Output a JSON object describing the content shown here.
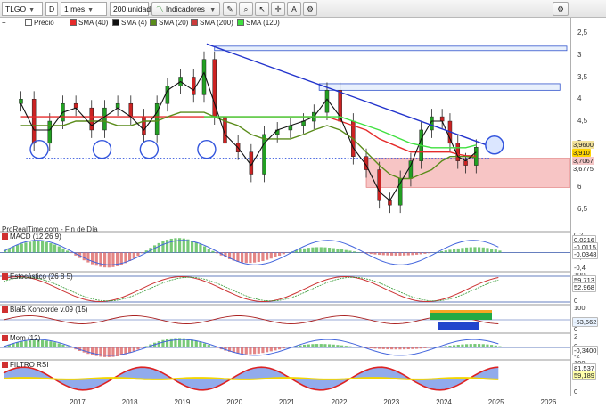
{
  "toolbar": {
    "ticker": "TLGO",
    "mode": "D",
    "period": "1 mes",
    "units": "200 unidades",
    "indicators_label": "Indicadores"
  },
  "legend": {
    "price_label": "Precio",
    "sma40": "SMA (40)",
    "sma4": "SMA (4)",
    "sma20": "SMA (20)",
    "sma200": "SMA (200)",
    "sma120": "SMA (120)"
  },
  "source_label": "ProRealTime.com - Fin de Día",
  "colors": {
    "up": "#22a022",
    "down": "#cc2222",
    "sma40": "#e52b2b",
    "sma4": "#111111",
    "sma20": "#5a8c1a",
    "sma120": "#3fe03f",
    "trendline": "#2233cc",
    "support": "#3355dd",
    "zone": "#f7c5c5"
  },
  "price_pane": {
    "axis_ticks": [
      "6,5",
      "6",
      "5,5",
      "5",
      "4,5",
      "4",
      "3,5",
      "3",
      "2,5"
    ],
    "badges": [
      {
        "text": "3,9600",
        "bg": "#f3e39c"
      },
      {
        "text": "3,910",
        "bg": "#ffd400"
      },
      {
        "text": "3,7067",
        "bg": "#f4c7c7"
      },
      {
        "text": "3,6775",
        "bg": "#ffffff"
      }
    ]
  },
  "panes": [
    {
      "title": "MACD (12 26 9)",
      "ticks": [
        "0,2",
        "0",
        "-0,2",
        "-0,4"
      ],
      "badges": [
        {
          "text": "0,0216",
          "bg": "#ffffff"
        },
        {
          "text": "-0,0115",
          "bg": "#ffffff"
        },
        {
          "text": "-0,0348",
          "bg": "#ffffff"
        }
      ]
    },
    {
      "title": "Estocástico (26 8 5)",
      "ticks": [
        "100",
        "0"
      ],
      "badges": [
        {
          "text": "59,713",
          "bg": "#ffffff"
        },
        {
          "text": "52,968",
          "bg": "#ffffff"
        }
      ]
    },
    {
      "title": "Blai5 Koncorde v.09 (15)",
      "ticks": [
        "100",
        "0"
      ],
      "badges": [
        {
          "text": "-53,662",
          "bg": "#e9f3ff"
        }
      ]
    },
    {
      "title": "Mom (12)",
      "ticks": [
        "2",
        "0",
        "-2"
      ],
      "badges": [
        {
          "text": "-0,3400",
          "bg": "#ffffff"
        }
      ]
    },
    {
      "title": "FILTRO RSI",
      "ticks": [
        "100",
        "0"
      ],
      "badges": [
        {
          "text": "81,537",
          "bg": "#ffffff"
        },
        {
          "text": "59,189",
          "bg": "#ffffaa"
        }
      ]
    }
  ],
  "chart_data": {
    "type": "line",
    "subtype": "candlestick",
    "title": "TLGO",
    "ticker": "TLGO",
    "timeframe": "1 mes",
    "x_ticks": [
      "2017",
      "2018",
      "2019",
      "2020",
      "2021",
      "2022",
      "2023",
      "2024",
      "2025",
      "2026"
    ],
    "ylim": [
      2.2,
      6.6
    ],
    "y_ticks": [
      2.5,
      3,
      3.5,
      4,
      4.5,
      5,
      5.5,
      6,
      6.5
    ],
    "x": [
      2016.4,
      2016.65,
      2016.95,
      2017.2,
      2017.45,
      2017.75,
      2018.0,
      2018.25,
      2018.5,
      2018.75,
      2019.0,
      2019.2,
      2019.45,
      2019.7,
      2019.9,
      2020.1,
      2020.3,
      2020.55,
      2020.8,
      2021.05,
      2021.3,
      2021.55,
      2021.8,
      2022.0,
      2022.25,
      2022.5,
      2022.75,
      2023.0,
      2023.25,
      2023.45,
      2023.65,
      2023.85,
      2024.05,
      2024.25,
      2024.45,
      2024.6,
      2024.75,
      2024.9,
      2025.1
    ],
    "series": [
      {
        "name": "Precio",
        "values": [
          5.0,
          4.0,
          4.5,
          4.9,
          4.8,
          4.3,
          4.8,
          4.9,
          4.6,
          4.2,
          4.9,
          5.3,
          5.5,
          5.1,
          5.9,
          4.6,
          4.0,
          3.8,
          3.3,
          4.2,
          4.3,
          4.4,
          4.5,
          4.7,
          5.2,
          4.5,
          3.7,
          3.4,
          2.7,
          2.6,
          3.2,
          3.6,
          4.3,
          4.6,
          4.5,
          4.0,
          3.6,
          3.5,
          3.91
        ]
      },
      {
        "name": "SMA (40)",
        "values": [
          4.6,
          4.6,
          4.6,
          4.6,
          4.6,
          4.6,
          4.6,
          4.6,
          4.6,
          4.6,
          4.6,
          4.6,
          4.6,
          4.6,
          4.6,
          4.6,
          4.6,
          4.6,
          4.6,
          4.6,
          4.6,
          4.6,
          4.6,
          4.6,
          4.6,
          4.5,
          4.4,
          4.3,
          4.1,
          4.0,
          3.9,
          3.8,
          3.8,
          3.8,
          3.8,
          3.8,
          3.75,
          3.72,
          3.71
        ]
      },
      {
        "name": "SMA (20)",
        "values": [
          4.4,
          4.4,
          4.4,
          4.4,
          4.5,
          4.5,
          4.5,
          4.4,
          4.4,
          4.5,
          4.5,
          4.6,
          4.7,
          4.7,
          4.7,
          4.6,
          4.5,
          4.4,
          4.2,
          4.1,
          4.1,
          4.1,
          4.2,
          4.3,
          4.4,
          4.3,
          4.1,
          3.8,
          3.5,
          3.3,
          3.2,
          3.2,
          3.3,
          3.4,
          3.6,
          3.7,
          3.7,
          3.7,
          3.68
        ]
      },
      {
        "name": "SMA (4)",
        "values": [
          4.9,
          4.3,
          4.3,
          4.7,
          4.8,
          4.4,
          4.6,
          4.8,
          4.6,
          4.3,
          4.7,
          5.2,
          5.4,
          5.2,
          5.6,
          4.9,
          4.2,
          3.9,
          3.5,
          4.0,
          4.3,
          4.4,
          4.5,
          4.6,
          5.0,
          4.6,
          3.9,
          3.5,
          2.9,
          2.7,
          3.1,
          3.5,
          4.1,
          4.5,
          4.5,
          4.1,
          3.7,
          3.6,
          3.8
        ]
      },
      {
        "name": "SMA (120)",
        "values": [
          null,
          null,
          null,
          null,
          null,
          null,
          null,
          null,
          null,
          null,
          null,
          null,
          null,
          null,
          4.6,
          4.6,
          4.6,
          4.6,
          4.6,
          4.6,
          4.6,
          4.6,
          4.6,
          4.6,
          4.6,
          4.6,
          4.5,
          4.4,
          4.3,
          4.2,
          4.1,
          4.0,
          3.95,
          3.9,
          3.9,
          3.9,
          3.9,
          3.9,
          3.96
        ]
      }
    ],
    "trendline": {
      "from": [
        2019.95,
        6.25
      ],
      "to": [
        2025.3,
        3.96
      ]
    },
    "resistance_zones": [
      [
        6.1,
        6.2
      ],
      [
        5.2,
        5.35
      ]
    ],
    "support_level": 3.66,
    "support_zone": [
      3.0,
      3.66
    ],
    "support_touches_x": [
      2016.75,
      2017.95,
      2018.85,
      2019.95
    ],
    "last_value": 3.91,
    "grid": false,
    "legend_position": "top-left"
  }
}
